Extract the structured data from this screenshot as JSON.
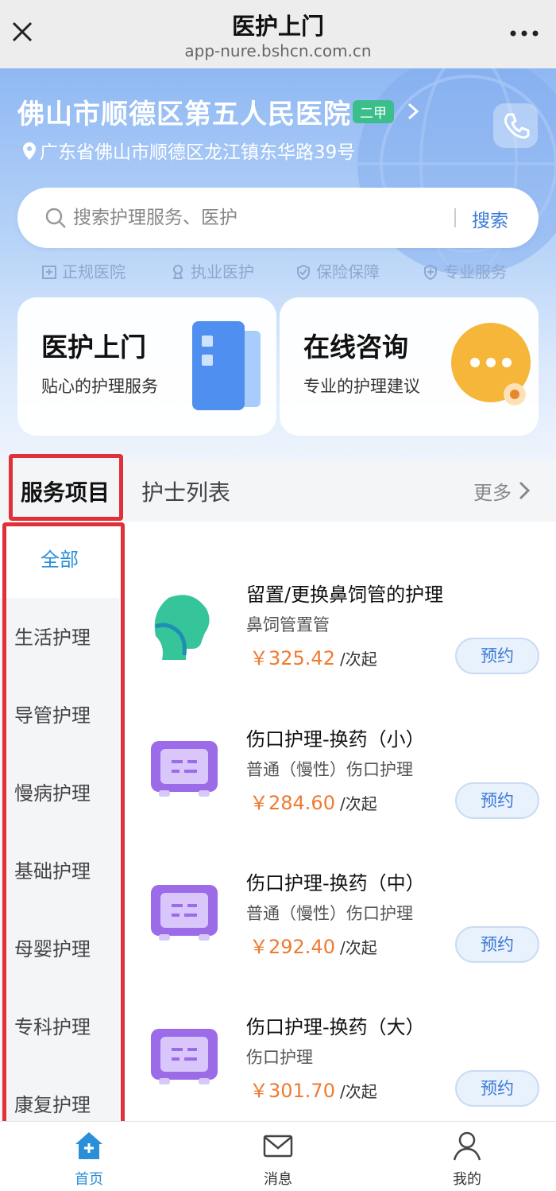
{
  "browser": {
    "title": "医护上门",
    "url": "app-nure.bshcn.com.cn"
  },
  "hospital": {
    "name": "佛山市顺德区第五人民医院",
    "grade": "二甲",
    "address": "广东省佛山市顺德区龙江镇东华路39号"
  },
  "search": {
    "placeholder": "搜索护理服务、医护",
    "button": "搜索"
  },
  "badges": [
    "正规医院",
    "执业医护",
    "保险保障",
    "专业服务"
  ],
  "cards": [
    {
      "title": "医护上门",
      "subtitle": "贴心的护理服务"
    },
    {
      "title": "在线咨询",
      "subtitle": "专业的护理建议"
    }
  ],
  "tabs": {
    "active": "服务项目",
    "second": "护士列表",
    "more": "更多"
  },
  "categories": [
    "全部",
    "生活护理",
    "导管护理",
    "慢病护理",
    "基础护理",
    "母婴护理",
    "专科护理",
    "康复护理"
  ],
  "services": [
    {
      "name": "留置/更换鼻饲管的护理",
      "sub": "鼻饲管置管",
      "price": "￥325.42",
      "unit": "/次起",
      "book": "预约",
      "icon": "head-profile-icon"
    },
    {
      "name": "伤口护理-换药（小）",
      "sub": "普通（慢性）伤口护理",
      "price": "￥284.60",
      "unit": "/次起",
      "book": "预约",
      "icon": "medicine-box-icon"
    },
    {
      "name": "伤口护理-换药（中）",
      "sub": "普通（慢性）伤口护理",
      "price": "￥292.40",
      "unit": "/次起",
      "book": "预约",
      "icon": "medicine-box-icon"
    },
    {
      "name": "伤口护理-换药（大）",
      "sub": "伤口护理",
      "price": "￥301.70",
      "unit": "/次起",
      "book": "预约",
      "icon": "medicine-box-icon"
    }
  ],
  "nav": [
    {
      "label": "首页",
      "icon": "home-icon",
      "active": true
    },
    {
      "label": "消息",
      "icon": "envelope-icon",
      "active": false
    },
    {
      "label": "我的",
      "icon": "person-icon",
      "active": false
    }
  ],
  "colors": {
    "accent": "#2b8fd8",
    "price": "#ef7a30",
    "highlight": "#e0303a",
    "grade": "#3bbf8a"
  }
}
